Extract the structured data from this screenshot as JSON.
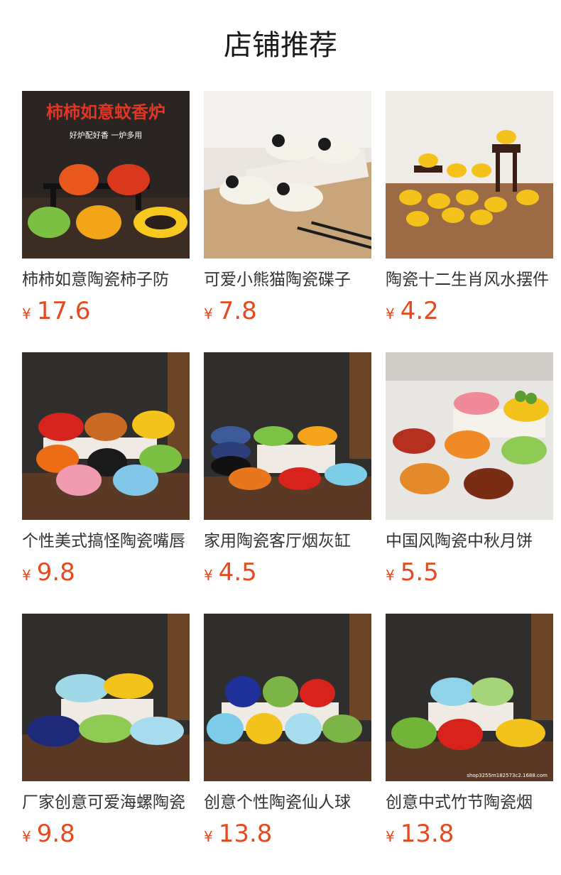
{
  "section_title": "店铺推荐",
  "products": [
    {
      "image_overlay_title": "柿柿如意蚊香炉",
      "image_overlay_subtitle": "好炉配好香 一炉多用",
      "name": "柿柿如意陶瓷柿子防",
      "currency": "¥",
      "price": "17.6"
    },
    {
      "name": "可爱小熊猫陶瓷碟子",
      "currency": "¥",
      "price": "7.8"
    },
    {
      "name": "陶瓷十二生肖风水摆件",
      "currency": "¥",
      "price": "4.2"
    },
    {
      "name": "个性美式搞怪陶瓷嘴唇",
      "currency": "¥",
      "price": "9.8"
    },
    {
      "name": "家用陶瓷客厅烟灰缸",
      "currency": "¥",
      "price": "4.5"
    },
    {
      "name": "中国风陶瓷中秋月饼",
      "currency": "¥",
      "price": "5.5"
    },
    {
      "name": "厂家创意可爱海螺陶瓷",
      "currency": "¥",
      "price": "9.8"
    },
    {
      "name": "创意个性陶瓷仙人球",
      "currency": "¥",
      "price": "13.8"
    },
    {
      "image_watermark": "shop3255m182573c2.1688.com",
      "name": "创意中式竹节陶瓷烟",
      "currency": "¥",
      "price": "13.8"
    }
  ],
  "colors": {
    "price": "#e4491f",
    "title": "#1a1a1a"
  }
}
